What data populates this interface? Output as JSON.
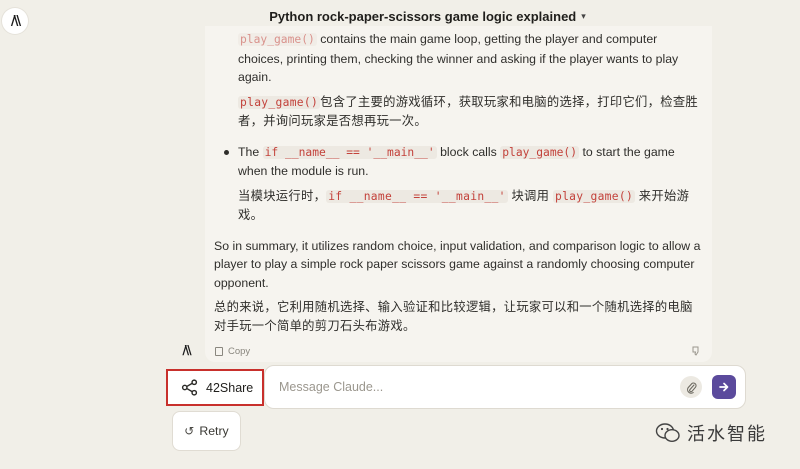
{
  "header": {
    "title": "Python rock-paper-scissors game logic explained",
    "chevron": "▾"
  },
  "message": {
    "b1_en_code": "play_game()",
    "b1_en_text": " contains the main game loop, getting the player and computer choices, printing them, checking the winner and asking if the player wants to play again.",
    "b1_zh_code": "play_game()",
    "b1_zh_text": "包含了主要的游戏循环，获取玩家和电脑的选择，打印它们，检查胜者，并询问玩家是否想再玩一次。",
    "b2_en_pre": "The ",
    "b2_en_code1": "if __name__ == '__main__'",
    "b2_en_mid": " block calls ",
    "b2_en_code2": "play_game()",
    "b2_en_post": " to start the game when the module is run.",
    "b2_zh_pre": "当模块运行时，",
    "b2_zh_code1": "if __name__ == '__main__'",
    "b2_zh_mid": " 块调用 ",
    "b2_zh_code2": "play_game()",
    "b2_zh_post": " 来开始游戏。",
    "summary_en": "So in summary, it utilizes random choice, input validation, and comparison logic to allow a player to play a simple rock paper scissors game against a randomly choosing computer opponent.",
    "summary_zh": "总的来说，它利用随机选择、输入验证和比较逻辑，让玩家可以和一个随机选择的电脑对手玩一个简单的剪刀石头布游戏。",
    "copy_label": "Copy"
  },
  "share": {
    "label": "42Share"
  },
  "input": {
    "placeholder": "Message Claude..."
  },
  "retry": {
    "label": "Retry"
  },
  "watermark": {
    "text": "活水智能"
  },
  "colors": {
    "background": "#f1efe8",
    "code": "#c3423b",
    "send": "#5b4a9c",
    "highlight_border": "#c8302c"
  },
  "icons": [
    "anthropic-logo",
    "chevron-down-icon",
    "copy-icon",
    "thumbs-down-icon",
    "share-icon",
    "paperclip-icon",
    "send-arrow-icon",
    "retry-icon",
    "wechat-icon"
  ]
}
